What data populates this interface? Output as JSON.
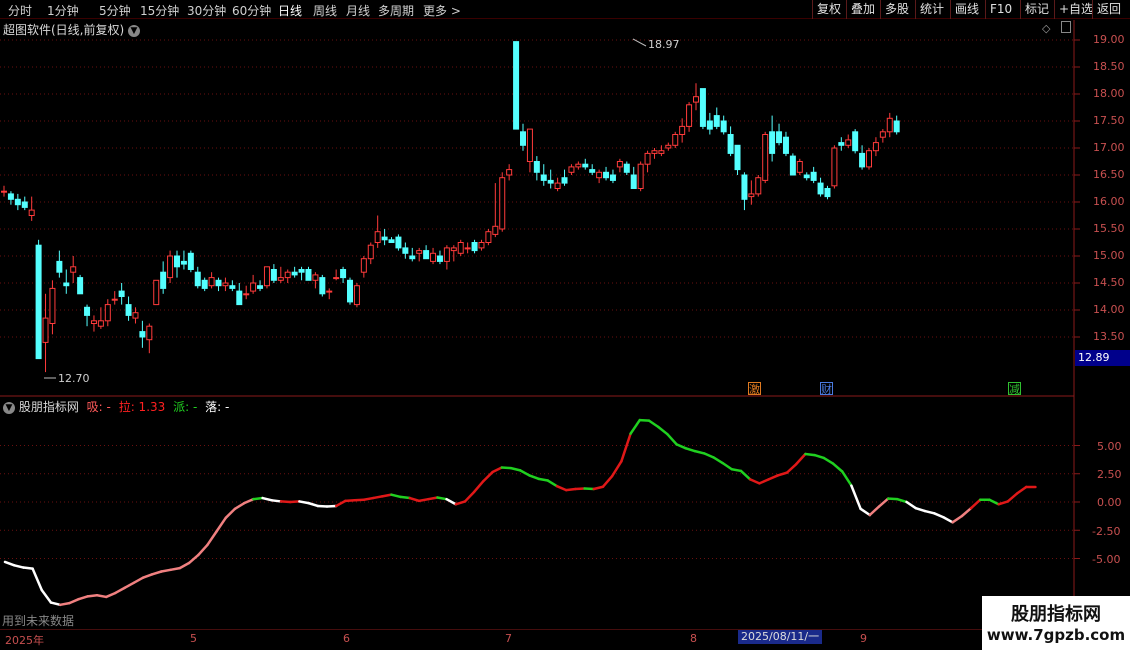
{
  "toolbar": {
    "periods": [
      "分时",
      "1分钟",
      "5分钟",
      "15分钟",
      "30分钟",
      "60分钟",
      "日线",
      "周线",
      "月线",
      "多周期",
      "更多"
    ],
    "active_period": "日线",
    "buttons": [
      "复权",
      "叠加",
      "多股",
      "统计",
      "画线",
      "F10",
      "标记",
      "+自选",
      "返回"
    ]
  },
  "main_chart": {
    "title": "超图软件(日线,前复权)",
    "high_label": "18.97",
    "low_label": "12.70",
    "current_price": "12.89",
    "y_ticks": [
      "19.00",
      "18.50",
      "18.00",
      "17.50",
      "17.00",
      "16.50",
      "16.00",
      "15.50",
      "15.00",
      "14.50",
      "14.00",
      "13.50"
    ],
    "events": [
      {
        "text": "激",
        "color": "#e07a20"
      },
      {
        "text": "财",
        "color": "#4a7adf"
      },
      {
        "text": "减",
        "color": "#30c030"
      }
    ]
  },
  "indicator": {
    "title": "股朋指标网",
    "labels": [
      {
        "text": "吸: -",
        "color": "#ff5a5a"
      },
      {
        "text": "拉: 1.33",
        "color": "#ff2020"
      },
      {
        "text": "派: -",
        "color": "#20d020"
      },
      {
        "text": "落: -",
        "color": "#ffffff"
      }
    ],
    "y_ticks": [
      "5.00",
      "2.50",
      "0.00",
      "-2.50",
      "-5.00"
    ],
    "colors": {
      "吸": "#f08080",
      "拉": "#e01818",
      "派": "#20d020",
      "落": "#ffffff"
    },
    "footer_note": "用到未来数据"
  },
  "date_axis": {
    "labels": [
      "2025年",
      "5",
      "6",
      "7",
      "8",
      "9"
    ],
    "cursor": "2025/08/11/一"
  },
  "watermark": {
    "name": "股朋指标网",
    "url": "www.7gpzb.com"
  },
  "chart_data": {
    "type": "candlestick",
    "price_axis": [
      12.7,
      18.97
    ],
    "candles": [
      [
        16.2,
        16.3,
        16.1,
        16.2
      ],
      [
        16.15,
        16.2,
        15.95,
        16.05
      ],
      [
        16.05,
        16.15,
        15.85,
        15.95
      ],
      [
        16.0,
        16.1,
        15.85,
        15.9
      ],
      [
        15.75,
        16.1,
        15.65,
        15.85
      ],
      [
        15.2,
        15.3,
        13.1,
        13.1
      ],
      [
        13.4,
        14.3,
        12.85,
        13.85
      ],
      [
        13.75,
        14.55,
        13.55,
        14.4
      ],
      [
        14.9,
        15.1,
        14.6,
        14.7
      ],
      [
        14.5,
        14.75,
        14.3,
        14.45
      ],
      [
        14.7,
        15.0,
        14.5,
        14.8
      ],
      [
        14.6,
        14.65,
        14.3,
        14.3
      ],
      [
        14.05,
        14.1,
        13.7,
        13.9
      ],
      [
        13.75,
        13.9,
        13.6,
        13.8
      ],
      [
        13.7,
        14.05,
        13.65,
        13.8
      ],
      [
        13.8,
        14.2,
        13.7,
        14.1
      ],
      [
        14.2,
        14.35,
        14.1,
        14.2
      ],
      [
        14.35,
        14.5,
        14.1,
        14.25
      ],
      [
        14.1,
        14.25,
        13.8,
        13.9
      ],
      [
        13.85,
        14.05,
        13.75,
        13.95
      ],
      [
        13.6,
        13.8,
        13.3,
        13.5
      ],
      [
        13.45,
        13.75,
        13.2,
        13.7
      ],
      [
        14.1,
        14.55,
        14.1,
        14.55
      ],
      [
        14.7,
        14.9,
        14.3,
        14.4
      ],
      [
        14.6,
        15.1,
        14.5,
        15.0
      ],
      [
        15.0,
        15.1,
        14.6,
        14.8
      ],
      [
        14.9,
        15.1,
        14.75,
        14.85
      ],
      [
        15.05,
        15.1,
        14.7,
        14.75
      ],
      [
        14.7,
        14.8,
        14.4,
        14.45
      ],
      [
        14.55,
        14.6,
        14.35,
        14.4
      ],
      [
        14.45,
        14.7,
        14.4,
        14.6
      ],
      [
        14.55,
        14.6,
        14.35,
        14.45
      ],
      [
        14.45,
        14.6,
        14.35,
        14.5
      ],
      [
        14.45,
        14.55,
        14.35,
        14.4
      ],
      [
        14.35,
        14.5,
        14.1,
        14.1
      ],
      [
        14.3,
        14.45,
        14.2,
        14.3
      ],
      [
        14.35,
        14.65,
        14.3,
        14.5
      ],
      [
        14.45,
        14.55,
        14.35,
        14.4
      ],
      [
        14.45,
        14.8,
        14.4,
        14.8
      ],
      [
        14.75,
        14.85,
        14.5,
        14.55
      ],
      [
        14.55,
        14.8,
        14.5,
        14.6
      ],
      [
        14.6,
        14.75,
        14.5,
        14.7
      ],
      [
        14.7,
        14.8,
        14.6,
        14.65
      ],
      [
        14.75,
        14.8,
        14.55,
        14.7
      ],
      [
        14.75,
        14.8,
        14.55,
        14.55
      ],
      [
        14.55,
        14.7,
        14.4,
        14.65
      ],
      [
        14.6,
        14.65,
        14.25,
        14.3
      ],
      [
        14.35,
        14.4,
        14.2,
        14.35
      ],
      [
        14.6,
        14.75,
        14.55,
        14.6
      ],
      [
        14.75,
        14.8,
        14.5,
        14.6
      ],
      [
        14.55,
        14.6,
        14.1,
        14.15
      ],
      [
        14.1,
        14.5,
        14.05,
        14.45
      ],
      [
        14.7,
        15.0,
        14.6,
        14.95
      ],
      [
        14.95,
        15.25,
        14.85,
        15.2
      ],
      [
        15.25,
        15.75,
        15.15,
        15.45
      ],
      [
        15.35,
        15.5,
        15.2,
        15.3
      ],
      [
        15.3,
        15.35,
        15.25,
        15.25
      ],
      [
        15.35,
        15.4,
        15.1,
        15.15
      ],
      [
        15.15,
        15.25,
        14.95,
        15.05
      ],
      [
        15.0,
        15.15,
        14.9,
        14.95
      ],
      [
        15.05,
        15.15,
        14.9,
        15.1
      ],
      [
        15.1,
        15.2,
        14.95,
        14.95
      ],
      [
        14.9,
        15.15,
        14.85,
        15.05
      ],
      [
        15.0,
        15.1,
        14.85,
        14.9
      ],
      [
        14.9,
        15.2,
        14.75,
        15.15
      ],
      [
        15.1,
        15.2,
        14.9,
        15.15
      ],
      [
        15.05,
        15.3,
        15.0,
        15.25
      ],
      [
        15.15,
        15.25,
        15.05,
        15.15
      ],
      [
        15.25,
        15.3,
        15.05,
        15.1
      ],
      [
        15.15,
        15.3,
        15.1,
        15.25
      ],
      [
        15.25,
        15.5,
        15.2,
        15.45
      ],
      [
        15.4,
        16.35,
        15.35,
        15.55
      ],
      [
        15.5,
        16.55,
        15.45,
        16.45
      ],
      [
        16.5,
        16.7,
        16.4,
        16.6
      ],
      [
        18.97,
        18.97,
        17.35,
        17.35
      ],
      [
        17.3,
        17.45,
        16.95,
        17.05
      ],
      [
        16.75,
        17.35,
        16.55,
        17.35
      ],
      [
        16.75,
        16.85,
        16.4,
        16.55
      ],
      [
        16.5,
        16.7,
        16.3,
        16.4
      ],
      [
        16.4,
        16.6,
        16.25,
        16.35
      ],
      [
        16.25,
        16.45,
        16.2,
        16.35
      ],
      [
        16.45,
        16.6,
        16.3,
        16.35
      ],
      [
        16.55,
        16.7,
        16.5,
        16.65
      ],
      [
        16.65,
        16.75,
        16.6,
        16.7
      ],
      [
        16.7,
        16.8,
        16.6,
        16.65
      ],
      [
        16.6,
        16.7,
        16.5,
        16.55
      ],
      [
        16.45,
        16.6,
        16.35,
        16.55
      ],
      [
        16.55,
        16.65,
        16.4,
        16.45
      ],
      [
        16.5,
        16.6,
        16.35,
        16.4
      ],
      [
        16.65,
        16.8,
        16.55,
        16.75
      ],
      [
        16.7,
        16.75,
        16.5,
        16.55
      ],
      [
        16.5,
        16.65,
        16.25,
        16.25
      ],
      [
        16.25,
        16.75,
        16.2,
        16.7
      ],
      [
        16.7,
        16.95,
        16.55,
        16.9
      ],
      [
        16.9,
        17.0,
        16.8,
        16.95
      ],
      [
        16.9,
        17.05,
        16.85,
        16.95
      ],
      [
        17.0,
        17.1,
        16.95,
        17.05
      ],
      [
        17.05,
        17.3,
        17.0,
        17.25
      ],
      [
        17.25,
        17.55,
        17.1,
        17.4
      ],
      [
        17.4,
        17.85,
        17.3,
        17.8
      ],
      [
        17.85,
        18.2,
        17.7,
        17.95
      ],
      [
        18.1,
        18.1,
        17.35,
        17.4
      ],
      [
        17.5,
        17.65,
        17.25,
        17.35
      ],
      [
        17.6,
        17.75,
        17.35,
        17.4
      ],
      [
        17.5,
        17.6,
        17.25,
        17.3
      ],
      [
        17.25,
        17.4,
        16.85,
        16.9
      ],
      [
        17.05,
        17.05,
        16.5,
        16.6
      ],
      [
        16.5,
        16.55,
        15.85,
        16.05
      ],
      [
        16.1,
        16.4,
        15.95,
        16.15
      ],
      [
        16.15,
        16.5,
        16.1,
        16.45
      ],
      [
        16.4,
        17.3,
        16.35,
        17.25
      ],
      [
        17.3,
        17.6,
        16.75,
        16.9
      ],
      [
        17.3,
        17.45,
        17.05,
        17.1
      ],
      [
        17.2,
        17.3,
        16.85,
        16.9
      ],
      [
        16.85,
        16.9,
        16.5,
        16.5
      ],
      [
        16.55,
        16.8,
        16.5,
        16.75
      ],
      [
        16.5,
        16.55,
        16.4,
        16.45
      ],
      [
        16.55,
        16.65,
        16.35,
        16.4
      ],
      [
        16.35,
        16.45,
        16.1,
        16.15
      ],
      [
        16.25,
        16.3,
        16.05,
        16.1
      ],
      [
        16.3,
        17.05,
        16.25,
        17.0
      ],
      [
        17.1,
        17.2,
        16.95,
        17.05
      ],
      [
        17.05,
        17.25,
        17.0,
        17.15
      ],
      [
        17.3,
        17.35,
        16.9,
        16.95
      ],
      [
        16.9,
        17.05,
        16.6,
        16.65
      ],
      [
        16.65,
        17.0,
        16.6,
        16.95
      ],
      [
        16.95,
        17.2,
        16.85,
        17.1
      ],
      [
        17.2,
        17.35,
        17.1,
        17.3
      ],
      [
        17.3,
        17.65,
        17.2,
        17.55
      ],
      [
        17.5,
        17.6,
        17.25,
        17.3
      ]
    ],
    "indicator_line": [
      {
        "v": -5.3,
        "c": "落"
      },
      {
        "v": -5.6,
        "c": "落"
      },
      {
        "v": -5.8,
        "c": "落"
      },
      {
        "v": -5.9,
        "c": "落"
      },
      {
        "v": -7.8,
        "c": "落"
      },
      {
        "v": -8.9,
        "c": "落"
      },
      {
        "v": -9.1,
        "c": "落"
      },
      {
        "v": -8.95,
        "c": "吸"
      },
      {
        "v": -8.6,
        "c": "吸"
      },
      {
        "v": -8.35,
        "c": "吸"
      },
      {
        "v": -8.25,
        "c": "吸"
      },
      {
        "v": -8.4,
        "c": "吸"
      },
      {
        "v": -8.05,
        "c": "吸"
      },
      {
        "v": -7.6,
        "c": "吸"
      },
      {
        "v": -7.15,
        "c": "吸"
      },
      {
        "v": -6.7,
        "c": "吸"
      },
      {
        "v": -6.4,
        "c": "吸"
      },
      {
        "v": -6.15,
        "c": "吸"
      },
      {
        "v": -6.0,
        "c": "吸"
      },
      {
        "v": -5.85,
        "c": "吸"
      },
      {
        "v": -5.4,
        "c": "吸"
      },
      {
        "v": -4.7,
        "c": "吸"
      },
      {
        "v": -3.8,
        "c": "吸"
      },
      {
        "v": -2.6,
        "c": "吸"
      },
      {
        "v": -1.4,
        "c": "吸"
      },
      {
        "v": -0.6,
        "c": "吸"
      },
      {
        "v": -0.1,
        "c": "吸"
      },
      {
        "v": 0.25,
        "c": "吸"
      },
      {
        "v": 0.35,
        "c": "派"
      },
      {
        "v": 0.15,
        "c": "落"
      },
      {
        "v": 0.05,
        "c": "落"
      },
      {
        "v": 0.0,
        "c": "拉"
      },
      {
        "v": 0.05,
        "c": "拉"
      },
      {
        "v": -0.1,
        "c": "落"
      },
      {
        "v": -0.35,
        "c": "落"
      },
      {
        "v": -0.4,
        "c": "落"
      },
      {
        "v": -0.35,
        "c": "落"
      },
      {
        "v": 0.1,
        "c": "拉"
      },
      {
        "v": 0.15,
        "c": "拉"
      },
      {
        "v": 0.2,
        "c": "拉"
      },
      {
        "v": 0.35,
        "c": "拉"
      },
      {
        "v": 0.5,
        "c": "拉"
      },
      {
        "v": 0.65,
        "c": "拉"
      },
      {
        "v": 0.45,
        "c": "派"
      },
      {
        "v": 0.35,
        "c": "派"
      },
      {
        "v": 0.1,
        "c": "拉"
      },
      {
        "v": 0.25,
        "c": "拉"
      },
      {
        "v": 0.4,
        "c": "拉"
      },
      {
        "v": 0.25,
        "c": "派"
      },
      {
        "v": -0.2,
        "c": "落"
      },
      {
        "v": 0.05,
        "c": "拉"
      },
      {
        "v": 0.9,
        "c": "拉"
      },
      {
        "v": 1.85,
        "c": "拉"
      },
      {
        "v": 2.65,
        "c": "拉"
      },
      {
        "v": 3.05,
        "c": "拉"
      },
      {
        "v": 3.0,
        "c": "派"
      },
      {
        "v": 2.8,
        "c": "派"
      },
      {
        "v": 2.35,
        "c": "派"
      },
      {
        "v": 2.05,
        "c": "派"
      },
      {
        "v": 1.9,
        "c": "派"
      },
      {
        "v": 1.4,
        "c": "派"
      },
      {
        "v": 1.05,
        "c": "拉"
      },
      {
        "v": 1.15,
        "c": "拉"
      },
      {
        "v": 1.2,
        "c": "拉"
      },
      {
        "v": 1.15,
        "c": "派"
      },
      {
        "v": 1.35,
        "c": "拉"
      },
      {
        "v": 2.3,
        "c": "拉"
      },
      {
        "v": 3.6,
        "c": "拉"
      },
      {
        "v": 6.05,
        "c": "拉"
      },
      {
        "v": 7.25,
        "c": "派"
      },
      {
        "v": 7.2,
        "c": "派"
      },
      {
        "v": 6.65,
        "c": "派"
      },
      {
        "v": 6.0,
        "c": "派"
      },
      {
        "v": 5.1,
        "c": "派"
      },
      {
        "v": 4.75,
        "c": "派"
      },
      {
        "v": 4.5,
        "c": "派"
      },
      {
        "v": 4.3,
        "c": "派"
      },
      {
        "v": 3.95,
        "c": "派"
      },
      {
        "v": 3.45,
        "c": "派"
      },
      {
        "v": 2.9,
        "c": "派"
      },
      {
        "v": 2.75,
        "c": "派"
      },
      {
        "v": 2.0,
        "c": "派"
      },
      {
        "v": 1.65,
        "c": "拉"
      },
      {
        "v": 2.0,
        "c": "拉"
      },
      {
        "v": 2.35,
        "c": "拉"
      },
      {
        "v": 2.6,
        "c": "拉"
      },
      {
        "v": 3.35,
        "c": "拉"
      },
      {
        "v": 4.25,
        "c": "拉"
      },
      {
        "v": 4.15,
        "c": "派"
      },
      {
        "v": 3.9,
        "c": "派"
      },
      {
        "v": 3.4,
        "c": "派"
      },
      {
        "v": 2.7,
        "c": "派"
      },
      {
        "v": 1.45,
        "c": "派"
      },
      {
        "v": -0.6,
        "c": "落"
      },
      {
        "v": -1.15,
        "c": "落"
      },
      {
        "v": -0.4,
        "c": "吸"
      },
      {
        "v": 0.3,
        "c": "吸"
      },
      {
        "v": 0.25,
        "c": "派"
      },
      {
        "v": 0.0,
        "c": "派"
      },
      {
        "v": -0.55,
        "c": "落"
      },
      {
        "v": -0.8,
        "c": "落"
      },
      {
        "v": -1.0,
        "c": "落"
      },
      {
        "v": -1.35,
        "c": "落"
      },
      {
        "v": -1.8,
        "c": "落"
      },
      {
        "v": -1.25,
        "c": "吸"
      },
      {
        "v": -0.55,
        "c": "吸"
      },
      {
        "v": 0.2,
        "c": "拉"
      },
      {
        "v": 0.2,
        "c": "派"
      },
      {
        "v": -0.2,
        "c": "派"
      },
      {
        "v": 0.05,
        "c": "拉"
      },
      {
        "v": 0.75,
        "c": "拉"
      },
      {
        "v": 1.33,
        "c": "拉"
      },
      {
        "v": 1.33,
        "c": "拉"
      }
    ],
    "indicator_axis": [
      -10,
      9.5
    ]
  }
}
